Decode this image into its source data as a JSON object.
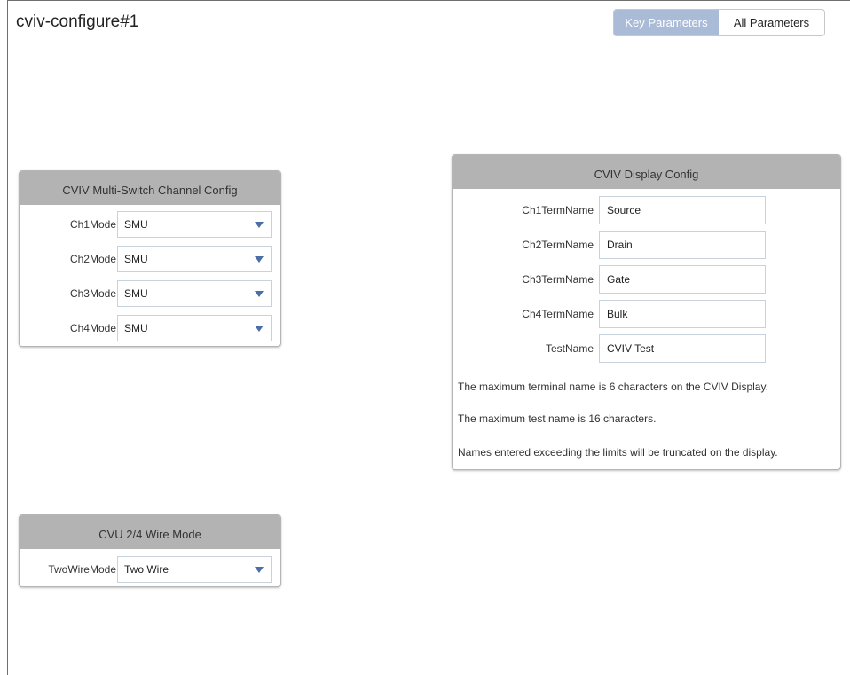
{
  "window": {
    "title": "cviv-configure#1"
  },
  "toggle": {
    "key_label": "Key Parameters",
    "all_label": "All Parameters",
    "active": "Key Parameters"
  },
  "multi_switch": {
    "title": "CVIV Multi-Switch Channel Config",
    "rows": [
      {
        "label": "Ch1Mode",
        "value": "SMU"
      },
      {
        "label": "Ch2Mode",
        "value": "SMU"
      },
      {
        "label": "Ch3Mode",
        "value": "SMU"
      },
      {
        "label": "Ch4Mode",
        "value": "SMU"
      }
    ]
  },
  "display_config": {
    "title": "CVIV Display Config",
    "rows": [
      {
        "label": "Ch1TermName",
        "value": "Source"
      },
      {
        "label": "Ch2TermName",
        "value": "Drain"
      },
      {
        "label": "Ch3TermName",
        "value": "Gate"
      },
      {
        "label": "Ch4TermName",
        "value": "Bulk"
      },
      {
        "label": "TestName",
        "value": "CVIV Test"
      }
    ],
    "notes": [
      "The maximum terminal name is 6 characters on the CVIV Display.",
      "The maximum test name is 16 characters.",
      "Names entered exceeding the limits will be truncated on the display."
    ]
  },
  "cvu_wire": {
    "title": "CVU 2/4 Wire Mode",
    "row": {
      "label": "TwoWireMode",
      "value": "Two Wire"
    }
  },
  "colors": {
    "toggle_active": "#aabbd8",
    "panel_header": "#b3b3b3",
    "dropdown_arrow": "#4a6ea8"
  },
  "icons": {
    "dropdown": "chevron-down-icon"
  }
}
